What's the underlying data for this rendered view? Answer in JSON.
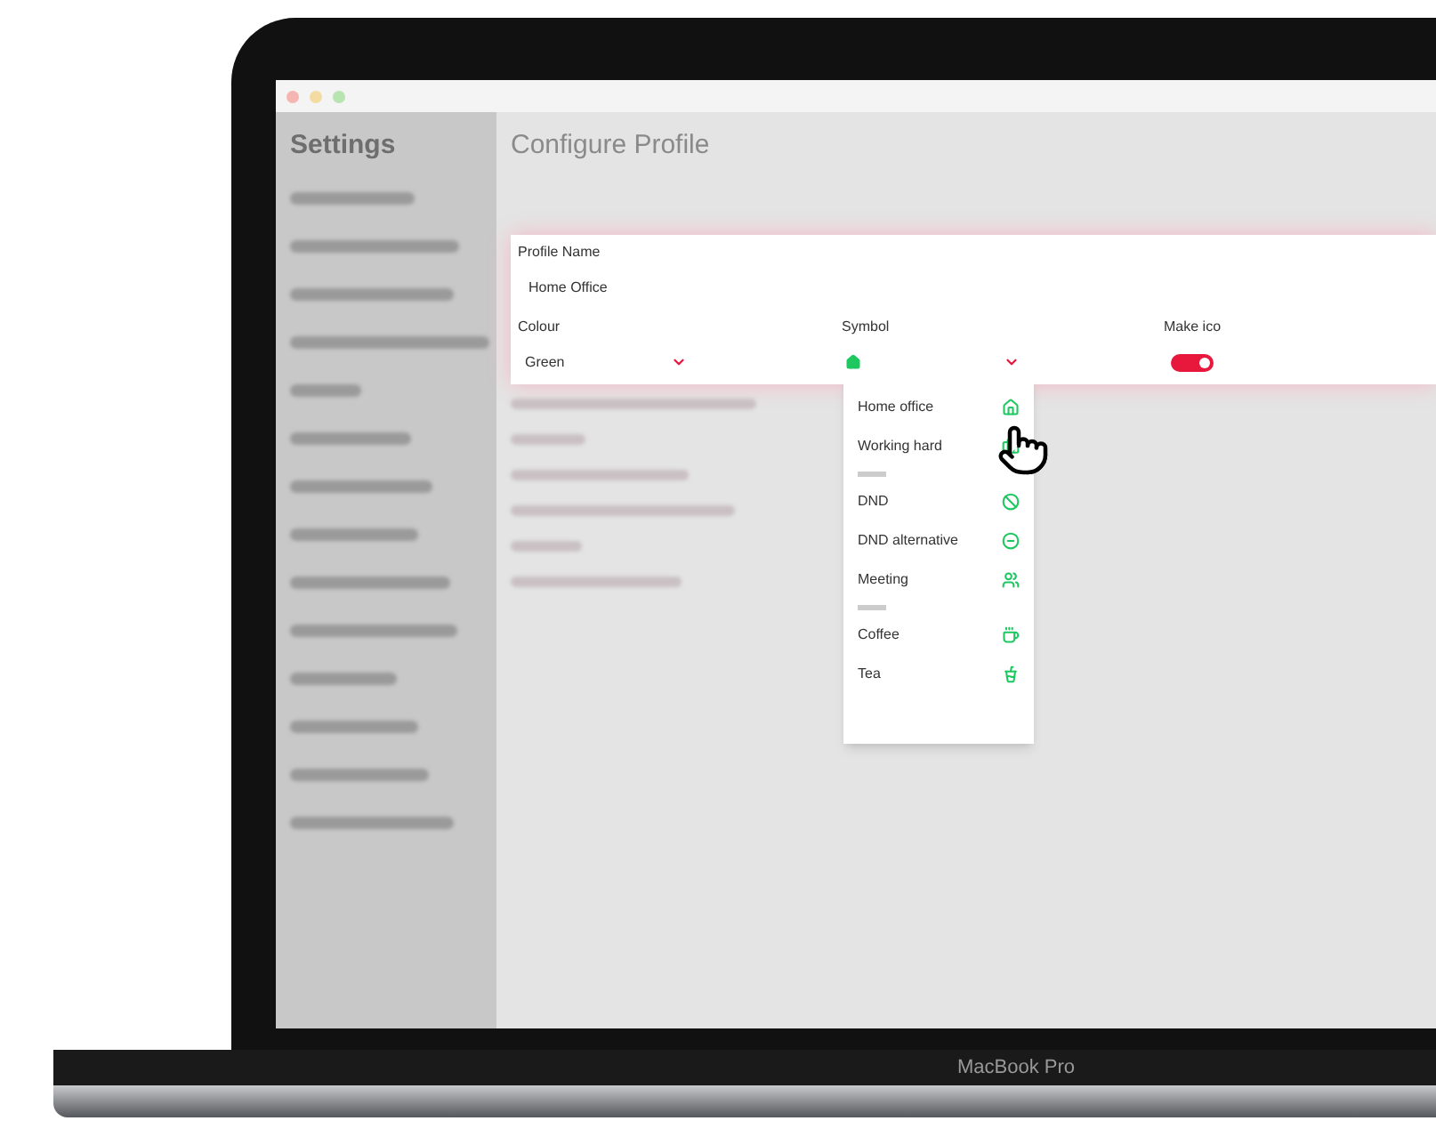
{
  "sidebar": {
    "title": "Settings"
  },
  "main": {
    "title": "Configure Profile"
  },
  "profile_form": {
    "name_label": "Profile Name",
    "name_value": "Home Office",
    "colour_label": "Colour",
    "colour_value": "Green",
    "symbol_label": "Symbol",
    "toggle_label": "Make ico",
    "toggle_on": true
  },
  "symbol_menu": [
    {
      "kind": "item",
      "label": "Home office"
    },
    {
      "kind": "item",
      "label": "Working hard"
    },
    {
      "kind": "header"
    },
    {
      "kind": "item",
      "label": "DND"
    },
    {
      "kind": "item",
      "label": "DND alternative"
    },
    {
      "kind": "item",
      "label": "Meeting"
    },
    {
      "kind": "header"
    },
    {
      "kind": "item",
      "label": "Coffee"
    },
    {
      "kind": "item",
      "label": "Tea"
    }
  ],
  "device": {
    "label": "MacBook Pro"
  }
}
